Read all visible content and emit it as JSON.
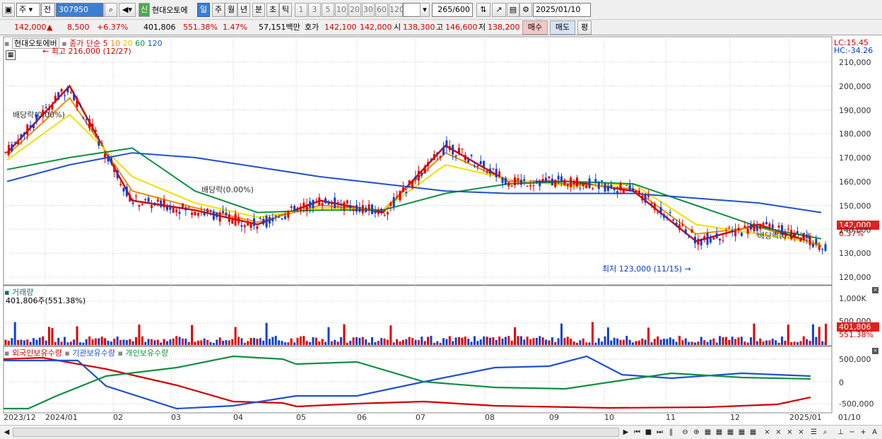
{
  "toolbar": {
    "market_label": "주",
    "period_label": "전",
    "code": "307950",
    "name": "현대오토에",
    "name_flag": "신",
    "period_tabs": [
      "일",
      "주",
      "월",
      "년",
      "분",
      "초",
      "틱"
    ],
    "period_selected": "일",
    "interval_tabs": [
      "1",
      "3",
      "5",
      "10",
      "20",
      "30",
      "60",
      "120"
    ],
    "count": "265",
    "count_total": "/600",
    "date": "2025/01/10"
  },
  "quote": {
    "price": "142,000",
    "change_arrow": "▲",
    "change": "8,500",
    "change_pct": "+6.37%",
    "volume": "401,806",
    "volume_ratio": "551.38%",
    "turnover": "1.47%",
    "amount": "57,151백만",
    "bid_label": "호가",
    "bid": "142,100",
    "ask": "142,000",
    "open_label": "시",
    "open": "138,300",
    "high_label": "고",
    "high": "146,600",
    "low_label": "저",
    "low": "138,200",
    "buy_label": "매수",
    "sell_label": "매도",
    "eval_label": "평"
  },
  "price_panel": {
    "title": "현대오토에버",
    "legend_prefix": "종가 단순",
    "ma_labels": [
      "5",
      "10",
      "20",
      "60",
      "120"
    ],
    "ma_colors": [
      "#d40000",
      "#f08c00",
      "#f0e000",
      "#109040",
      "#2050d0"
    ],
    "lc_label": "LC:15.45",
    "hc_label": "HC:-34.26",
    "high_annotation": "최고 216,000 (12/27)",
    "low_annotation": "최저 123,000 (11/15)",
    "dividend_label": "배당락(0.00%)",
    "last_price_tag": "142,000",
    "last_pct_tag": "6.37%",
    "y_ticks": [
      "210,000",
      "200,000",
      "190,000",
      "180,000",
      "170,000",
      "160,000",
      "150,000",
      "140,000",
      "130,000",
      "120,000"
    ]
  },
  "volume_panel": {
    "title": "거래량",
    "value_label": "401,806주(551.38%)",
    "y_ticks": [
      "1,000K",
      "500,000"
    ],
    "last_tag": "401,806",
    "last_pct": "551.38%"
  },
  "holder_panel": {
    "series": [
      "외국인보유수량",
      "기관보유수량",
      "개인보유수량"
    ],
    "colors": [
      "#d40000",
      "#2050d0",
      "#109040"
    ],
    "y_ticks": [
      "500,000",
      "0",
      "-500,000"
    ]
  },
  "x_axis": [
    "2023/12",
    "2024/01",
    "02",
    "03",
    "04",
    "05",
    "06",
    "07",
    "08",
    "09",
    "10",
    "11",
    "12",
    "2025/01",
    "01/10"
  ],
  "chart_data": {
    "type": "line",
    "title": "현대오토에버",
    "ylim": [
      117000,
      220000
    ],
    "x": [
      "2023/12",
      "2024/01",
      "02",
      "03",
      "04",
      "05",
      "06",
      "07",
      "08",
      "09",
      "10",
      "11",
      "12",
      "2025/01"
    ],
    "series": [
      {
        "name": "5",
        "values": [
          172000,
          200000,
          152000,
          148000,
          142000,
          152000,
          147000,
          175000,
          160000,
          160000,
          156000,
          135000,
          142000,
          133000
        ]
      },
      {
        "name": "10",
        "values": [
          171000,
          195000,
          156000,
          149000,
          143000,
          150000,
          148000,
          172000,
          160000,
          159000,
          157000,
          138000,
          141000,
          133000
        ]
      },
      {
        "name": "20",
        "values": [
          169000,
          188000,
          162000,
          151000,
          145000,
          149000,
          148000,
          167000,
          161000,
          158000,
          159000,
          142000,
          138000,
          134000
        ]
      },
      {
        "name": "60",
        "values": [
          165000,
          170000,
          174000,
          156000,
          147000,
          148000,
          148000,
          155000,
          159000,
          160000,
          159000,
          150000,
          141000,
          136000
        ]
      },
      {
        "name": "120",
        "values": [
          160000,
          167000,
          172000,
          170000,
          166000,
          162000,
          159000,
          156000,
          155000,
          155000,
          155000,
          153000,
          151000,
          147000
        ]
      }
    ]
  }
}
